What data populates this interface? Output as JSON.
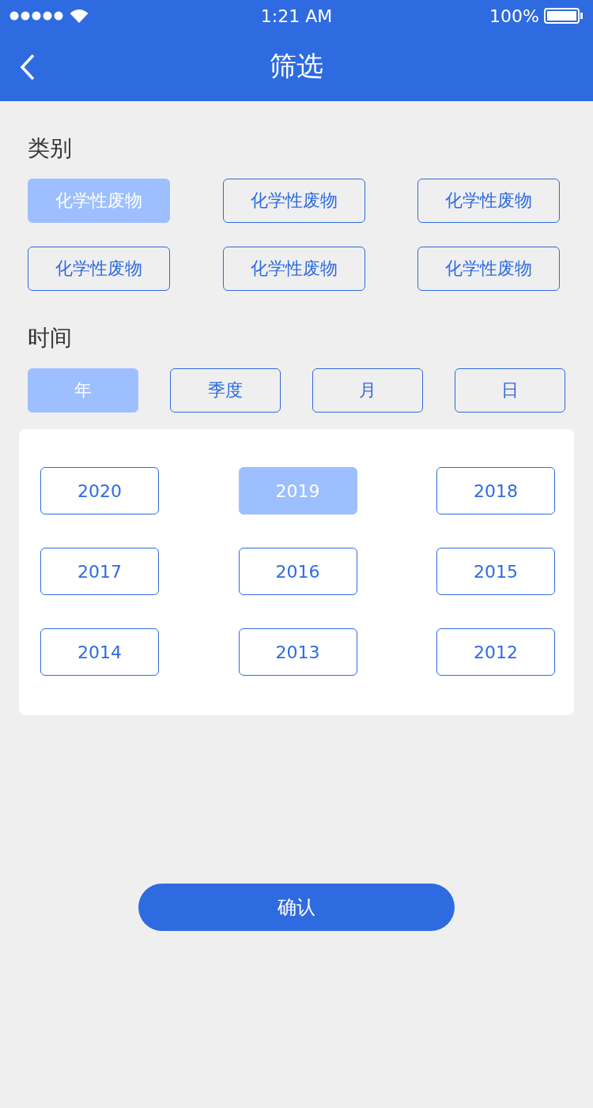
{
  "status_bar": {
    "time": "1:21 AM",
    "battery": "100%"
  },
  "nav": {
    "title": "筛选"
  },
  "category": {
    "label": "类别",
    "options": [
      {
        "label": "化学性废物",
        "selected": true
      },
      {
        "label": "化学性废物",
        "selected": false
      },
      {
        "label": "化学性废物",
        "selected": false
      },
      {
        "label": "化学性废物",
        "selected": false
      },
      {
        "label": "化学性废物",
        "selected": false
      },
      {
        "label": "化学性废物",
        "selected": false
      }
    ]
  },
  "time": {
    "label": "时间",
    "units": [
      {
        "label": "年",
        "selected": true
      },
      {
        "label": "季度",
        "selected": false
      },
      {
        "label": "月",
        "selected": false
      },
      {
        "label": "日",
        "selected": false
      }
    ]
  },
  "years": [
    {
      "label": "2020",
      "selected": false
    },
    {
      "label": "2019",
      "selected": true
    },
    {
      "label": "2018",
      "selected": false
    },
    {
      "label": "2017",
      "selected": false
    },
    {
      "label": "2016",
      "selected": false
    },
    {
      "label": "2015",
      "selected": false
    },
    {
      "label": "2014",
      "selected": false
    },
    {
      "label": "2013",
      "selected": false
    },
    {
      "label": "2012",
      "selected": false
    }
  ],
  "confirm": {
    "label": "确认"
  }
}
